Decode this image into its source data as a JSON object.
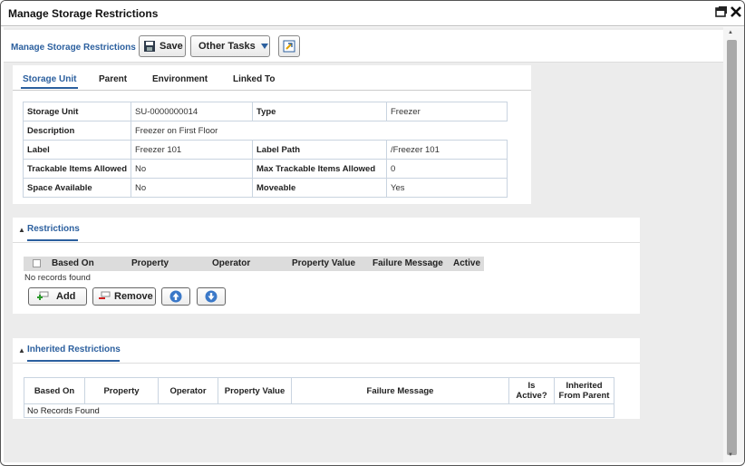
{
  "window": {
    "title": "Manage Storage Restrictions"
  },
  "toolbar": {
    "breadcrumb": "Manage Storage Restrictions",
    "save_label": "Save",
    "other_tasks_label": "Other Tasks"
  },
  "tabs": [
    "Storage Unit",
    "Parent",
    "Environment",
    "Linked To"
  ],
  "storage_unit": {
    "rows": [
      [
        "Storage Unit",
        "SU-0000000014",
        "Type",
        "Freezer"
      ],
      [
        "Description",
        "Freezer on First Floor",
        "",
        ""
      ],
      [
        "Label",
        "Freezer 101",
        "Label Path",
        "/Freezer 101"
      ],
      [
        "Trackable Items Allowed",
        "No",
        "Max Trackable Items Allowed",
        "0"
      ],
      [
        "Space Available",
        "No",
        "Moveable",
        "Yes"
      ]
    ]
  },
  "restrictions": {
    "title": "Restrictions",
    "columns": [
      "Based On",
      "Property",
      "Operator",
      "Property Value",
      "Failure Message",
      "Active"
    ],
    "empty_text": "No records found",
    "add_label": "Add",
    "remove_label": "Remove"
  },
  "inherited": {
    "title": "Inherited Restrictions",
    "columns": [
      "Based On",
      "Property",
      "Operator",
      "Property Value",
      "Failure Message",
      "Is Active?",
      "Inherited From Parent"
    ],
    "empty_text": "No Records Found"
  },
  "colors": {
    "accent": "#2b5f9e",
    "window_bg": "#ececec"
  }
}
